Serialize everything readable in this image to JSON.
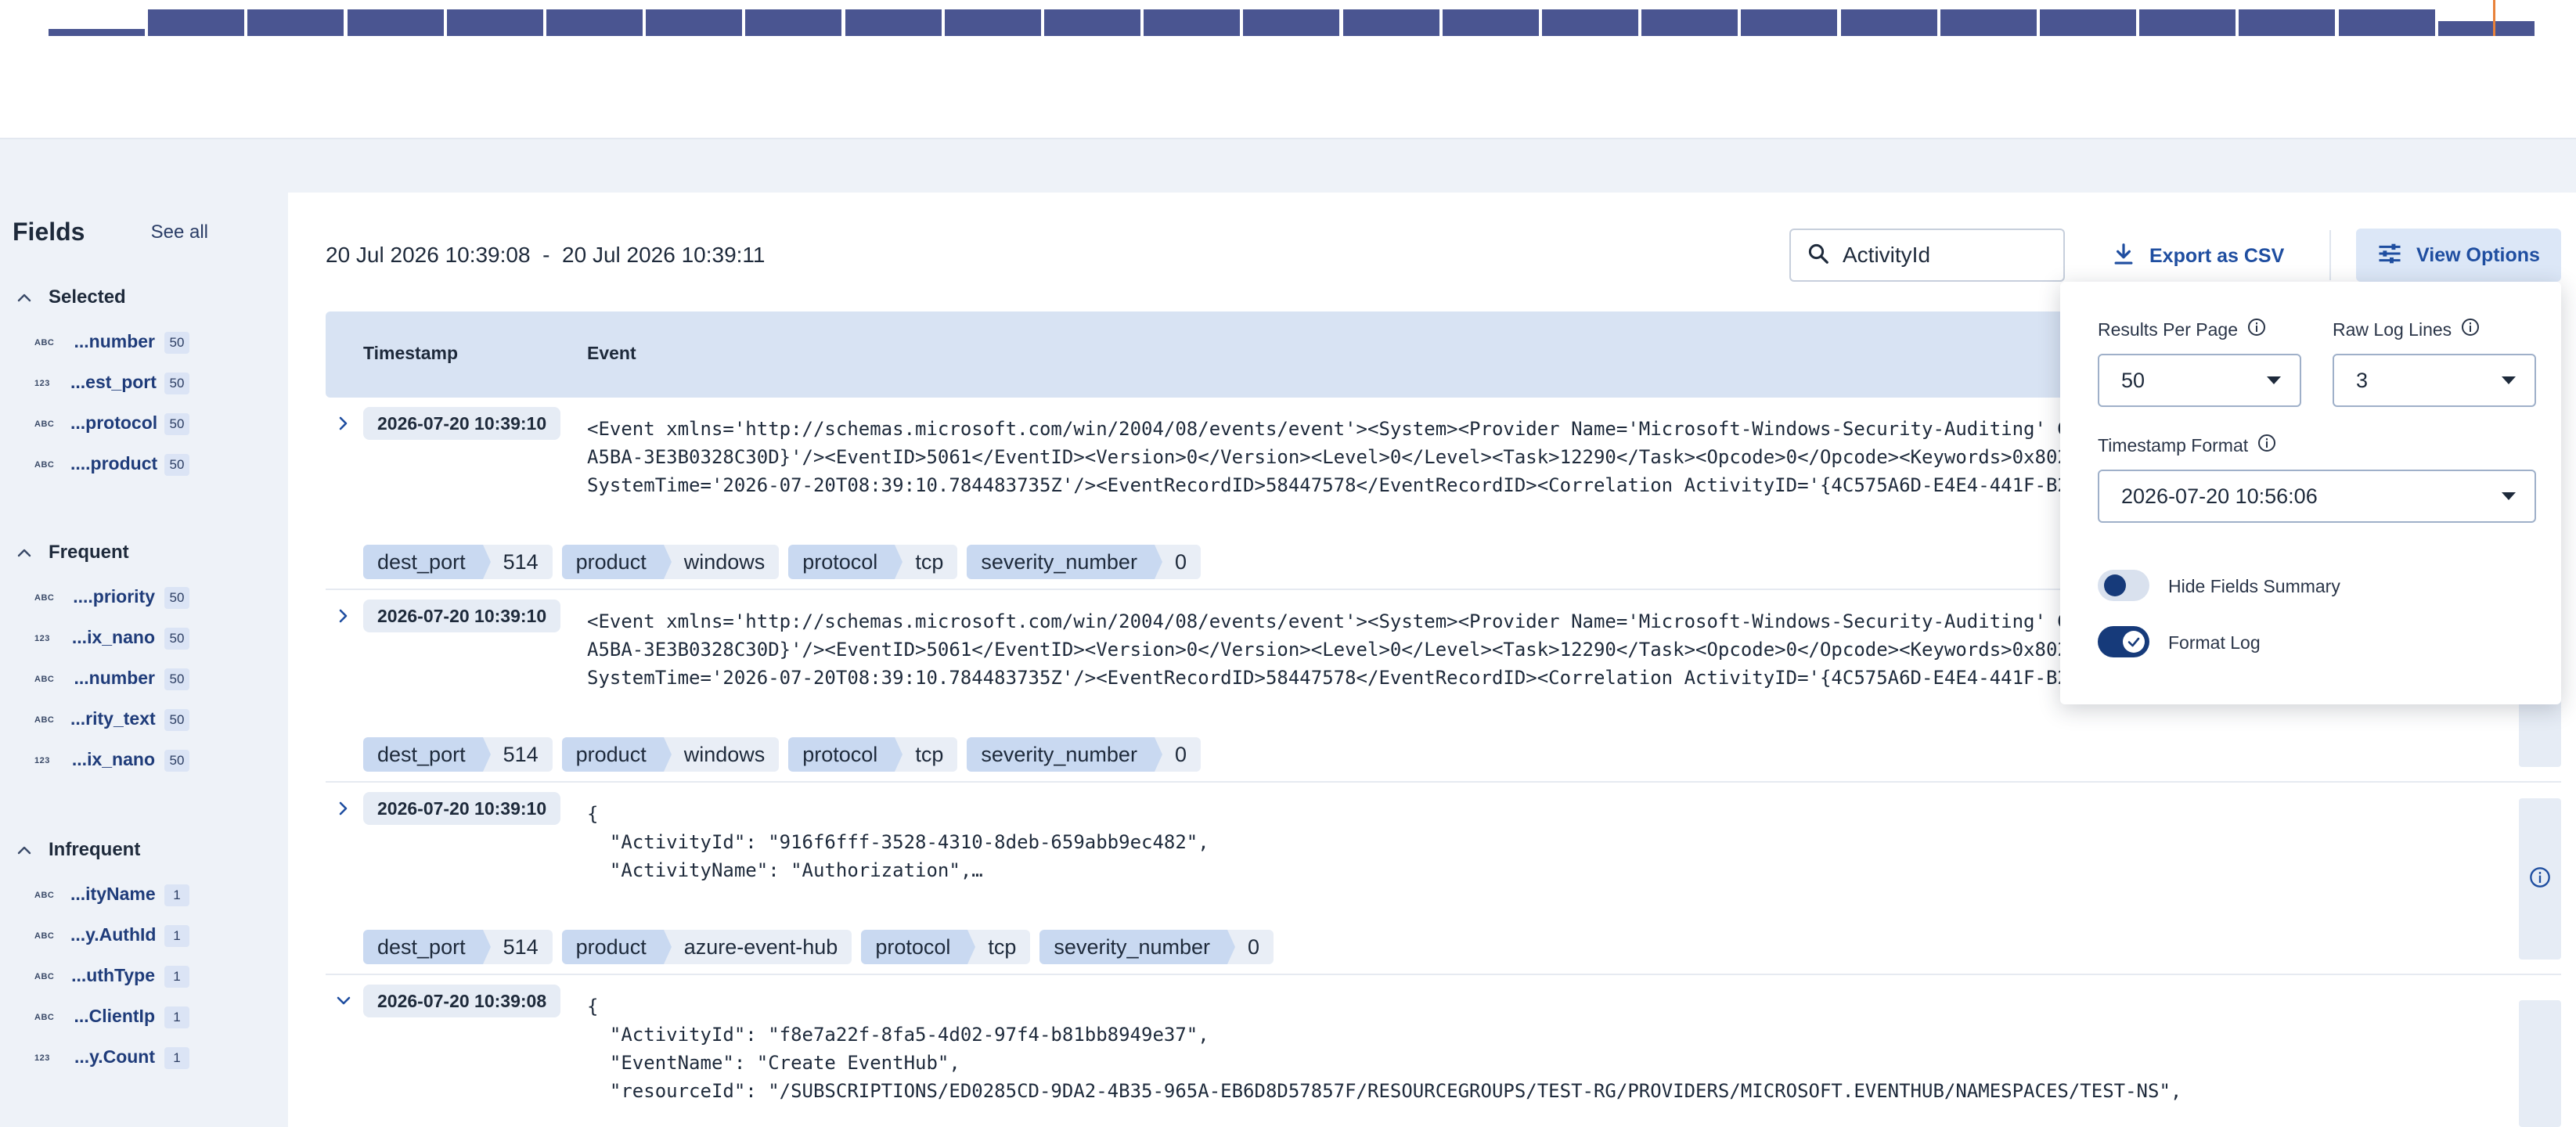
{
  "histogram": {
    "bar_color": "#4a5591",
    "marker_color": "#e8823a",
    "relative_heights": [
      0.25,
      1,
      1,
      1,
      1,
      1,
      1,
      1,
      1,
      1,
      1,
      1,
      1,
      1,
      1,
      1,
      1,
      1,
      1,
      1,
      1,
      1,
      1,
      1,
      0.55
    ]
  },
  "sidebar": {
    "title": "Fields",
    "see_all": "See all",
    "sections": [
      {
        "label": "Selected",
        "items": [
          {
            "type": "ABC",
            "name": "...number",
            "count": "50"
          },
          {
            "type": "123",
            "name": "...est_port",
            "count": "50"
          },
          {
            "type": "ABC",
            "name": "...protocol",
            "count": "50"
          },
          {
            "type": "ABC",
            "name": "....product",
            "count": "50"
          }
        ]
      },
      {
        "label": "Frequent",
        "items": [
          {
            "type": "ABC",
            "name": "....priority",
            "count": "50"
          },
          {
            "type": "123",
            "name": "...ix_nano",
            "count": "50"
          },
          {
            "type": "ABC",
            "name": "...number",
            "count": "50"
          },
          {
            "type": "ABC",
            "name": "...rity_text",
            "count": "50"
          },
          {
            "type": "123",
            "name": "...ix_nano",
            "count": "50"
          }
        ]
      },
      {
        "label": "Infrequent",
        "items": [
          {
            "type": "ABC",
            "name": "...ityName",
            "count": "1"
          },
          {
            "type": "ABC",
            "name": "...y.AuthId",
            "count": "1"
          },
          {
            "type": "ABC",
            "name": "...uthType",
            "count": "1"
          },
          {
            "type": "ABC",
            "name": "...ClientIp",
            "count": "1"
          },
          {
            "type": "123",
            "name": "...y.Count",
            "count": "1"
          }
        ]
      }
    ]
  },
  "toolbar": {
    "range_start": "20 Jul 2026 10:39:08",
    "range_sep": "-",
    "range_end": "20 Jul 2026 10:39:11",
    "search_value": "ActivityId",
    "export_label": "Export as CSV",
    "view_options_label": "View Options"
  },
  "table": {
    "col_timestamp": "Timestamp",
    "col_event": "Event",
    "rows": [
      {
        "timestamp": "2026-07-20 10:39:10",
        "expanded": false,
        "code": "<Event xmlns='http://schemas.microsoft.com/win/2004/08/events/event'><System><Provider Name='Microsoft-Windows-Security-Auditing' G\nA5BA-3E3B0328C30D}'/><EventID>5061</EventID><Version>0</Version><Level>0</Level><Task>12290</Task><Opcode>0</Opcode><Keywords>0x802\nSystemTime='2026-07-20T08:39:10.784483735Z'/><EventRecordID>58447578</EventRecordID><Correlation ActivityID='{4C575A6D-E4E4-441F-B2",
        "tags": [
          {
            "k": "dest_port",
            "v": "514"
          },
          {
            "k": "product",
            "v": "windows"
          },
          {
            "k": "protocol",
            "v": "tcp"
          },
          {
            "k": "severity_number",
            "v": "0"
          }
        ]
      },
      {
        "timestamp": "2026-07-20 10:39:10",
        "expanded": false,
        "code": "<Event xmlns='http://schemas.microsoft.com/win/2004/08/events/event'><System><Provider Name='Microsoft-Windows-Security-Auditing' G\nA5BA-3E3B0328C30D}'/><EventID>5061</EventID><Version>0</Version><Level>0</Level><Task>12290</Task><Opcode>0</Opcode><Keywords>0x802\nSystemTime='2026-07-20T08:39:10.784483735Z'/><EventRecordID>58447578</EventRecordID><Correlation ActivityID='{4C575A6D-E4E4-441F-B2",
        "tags": [
          {
            "k": "dest_port",
            "v": "514"
          },
          {
            "k": "product",
            "v": "windows"
          },
          {
            "k": "protocol",
            "v": "tcp"
          },
          {
            "k": "severity_number",
            "v": "0"
          }
        ]
      },
      {
        "timestamp": "2026-07-20 10:39:10",
        "expanded": false,
        "code": "{\n  \"ActivityId\": \"916f6fff-3528-4310-8deb-659abb9ec482\",\n  \"ActivityName\": \"Authorization\",…",
        "tags": [
          {
            "k": "dest_port",
            "v": "514"
          },
          {
            "k": "product",
            "v": "azure-event-hub"
          },
          {
            "k": "protocol",
            "v": "tcp"
          },
          {
            "k": "severity_number",
            "v": "0"
          }
        ]
      },
      {
        "timestamp": "2026-07-20 10:39:08",
        "expanded": true,
        "code": "{\n  \"ActivityId\": \"f8e7a22f-8fa5-4d02-97f4-b81bb8949e37\",\n  \"EventName\": \"Create EventHub\",\n  \"resourceId\": \"/SUBSCRIPTIONS/ED0285CD-9DA2-4B35-965A-EB6D8D57857F/RESOURCEGROUPS/TEST-RG/PROVIDERS/MICROSOFT.EVENTHUB/NAMESPACES/TEST-NS\",",
        "tags": []
      }
    ]
  },
  "view_options": {
    "results_per_page_label": "Results Per Page",
    "results_per_page_value": "50",
    "raw_log_lines_label": "Raw Log Lines",
    "raw_log_lines_value": "3",
    "timestamp_format_label": "Timestamp Format",
    "timestamp_format_value": "2026-07-20 10:56:06",
    "hide_fields_summary_label": "Hide Fields Summary",
    "hide_fields_summary_on": false,
    "format_log_label": "Format Log",
    "format_log_on": true
  },
  "colors": {
    "accent": "#1f4ea0",
    "toggle_on": "#163a7a",
    "header_bg": "#d8e3f3"
  }
}
